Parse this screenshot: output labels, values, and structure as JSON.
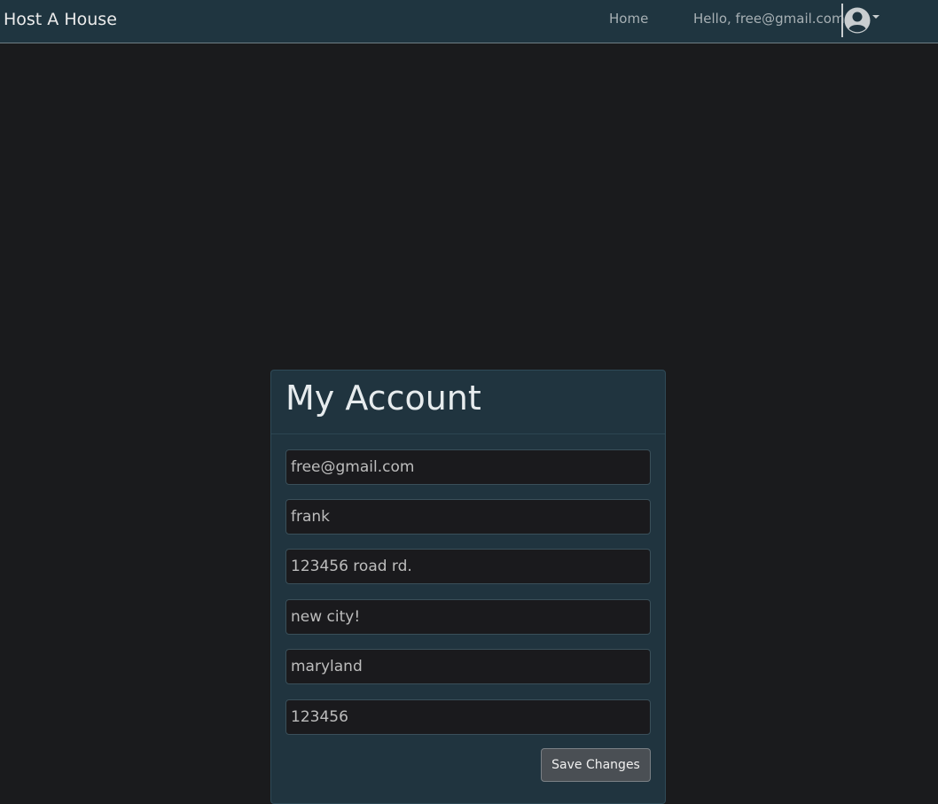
{
  "navbar": {
    "brand": "Host A House",
    "home_label": "Home",
    "greeting": "Hello, free@gmail.com",
    "user_icon": "user-circle-icon"
  },
  "account": {
    "title": "My Account",
    "fields": {
      "email": "free@gmail.com",
      "name": "frank",
      "street": "123456 road rd.",
      "city": "new city!",
      "state": "maryland",
      "zip": "123456"
    },
    "save_label": "Save Changes"
  },
  "colors": {
    "navbar_bg": "#1f3540",
    "page_bg": "#1a1b1d",
    "card_bg": "#20343f",
    "input_bg": "#1a1a1d",
    "button_bg": "#4a4f54"
  }
}
